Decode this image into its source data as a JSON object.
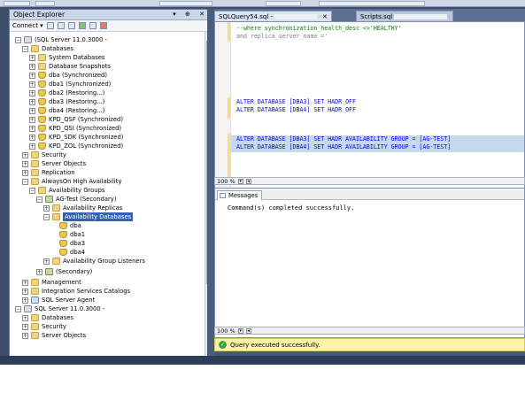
{
  "object_explorer": {
    "title": "Object Explorer",
    "controls": "▾ ⊕ ✕",
    "connect_label": "Connect ▾",
    "tree": [
      {
        "label": "(SQL Server 11.0.3000 -",
        "expander": "−",
        "icon": "server-icon"
      },
      {
        "label": "Databases",
        "expander": "−",
        "icon": "folder-icon"
      },
      {
        "label": "System Databases",
        "expander": "+",
        "icon": "folder-icon"
      },
      {
        "label": "Database Snapshots",
        "expander": "+",
        "icon": "folder-icon"
      },
      {
        "label": "dba (Synchronized)",
        "expander": "+",
        "icon": "database-icon"
      },
      {
        "label": "dba1 (Synchronized)",
        "expander": "+",
        "icon": "database-icon"
      },
      {
        "label": "dba2 (Restoring...)",
        "expander": "+",
        "icon": "database-icon"
      },
      {
        "label": "dba3 (Restoring...)",
        "expander": "+",
        "icon": "database-icon"
      },
      {
        "label": "dba4 (Restoring...)",
        "expander": "+",
        "icon": "database-icon"
      },
      {
        "label": "KPD_QSF (Synchronized)",
        "expander": "+",
        "icon": "database-icon"
      },
      {
        "label": "KPD_QSI (Synchronized)",
        "expander": "+",
        "icon": "database-icon"
      },
      {
        "label": "KPD_SDK (Synchronized)",
        "expander": "+",
        "icon": "database-icon"
      },
      {
        "label": "KPD_ZOL (Synchronized)",
        "expander": "+",
        "icon": "database-icon"
      },
      {
        "label": "Security",
        "expander": "+",
        "icon": "folder-icon"
      },
      {
        "label": "Server Objects",
        "expander": "+",
        "icon": "folder-icon"
      },
      {
        "label": "Replication",
        "expander": "+",
        "icon": "folder-icon"
      },
      {
        "label": "AlwaysOn High Availability",
        "expander": "−",
        "icon": "folder-icon"
      },
      {
        "label": "Availability Groups",
        "expander": "−",
        "icon": "folder-icon"
      },
      {
        "label": "AG-Test (Secondary)",
        "expander": "−",
        "icon": "availability-group-icon"
      },
      {
        "label": "Availability Replicas",
        "expander": "+",
        "icon": "folder-icon"
      },
      {
        "label": "Availability Databases",
        "expander": "−",
        "icon": "folder-icon"
      },
      {
        "label": "dba",
        "expander": "",
        "icon": "database-icon"
      },
      {
        "label": "dba1",
        "expander": "",
        "icon": "database-icon"
      },
      {
        "label": "dba3",
        "expander": "",
        "icon": "database-icon"
      },
      {
        "label": "dba4",
        "expander": "",
        "icon": "database-icon"
      },
      {
        "label": "Availability Group Listeners",
        "expander": "+",
        "icon": "folder-icon"
      },
      {
        "label": "(Secondary)",
        "expander": "+",
        "icon": "availability-group-icon"
      },
      {
        "label": "Management",
        "expander": "+",
        "icon": "folder-icon"
      },
      {
        "label": "Integration Services Catalogs",
        "expander": "+",
        "icon": "folder-icon"
      },
      {
        "label": "SQL Server Agent",
        "expander": "+",
        "icon": "agent-icon"
      },
      {
        "label": "SQL Server 11.0.3000 -",
        "expander": "−",
        "icon": "server-icon"
      },
      {
        "label": "Databases",
        "expander": "+",
        "icon": "folder-icon"
      },
      {
        "label": "Security",
        "expander": "+",
        "icon": "folder-icon"
      },
      {
        "label": "Server Objects",
        "expander": "+",
        "icon": "folder-icon"
      }
    ]
  },
  "tabs": {
    "query_tab": "SQLQuery54.sql -",
    "close": "✕",
    "scripts_tab": "Scripts.sql"
  },
  "editor": {
    "lines": [
      {
        "kind": "comment",
        "text": "--where synchronization_health_desc <>'HEALTHY'"
      },
      {
        "kind": "grey",
        "text": "and replica_server_name ='"
      },
      {
        "kind": "code",
        "text": "ALTER DATABASE [DBA3] SET HADR OFF"
      },
      {
        "kind": "code",
        "text": "ALTER DATABASE [DBA4] SET HADR OFF"
      },
      {
        "kind": "code",
        "text": "ALTER DATABASE [DBA3] SET HADR AVAILABILITY GROUP = [AG-TEST]"
      },
      {
        "kind": "code",
        "text": "ALTER DATABASE [DBA4] SET HADR AVAILABILITY GROUP = [AG-TEST]"
      }
    ],
    "zoom": "100 %"
  },
  "results": {
    "tab_label": "Messages",
    "message": "Command(s) completed successfully.",
    "zoom": "100 %"
  },
  "status": {
    "text": "Query executed successfully."
  }
}
